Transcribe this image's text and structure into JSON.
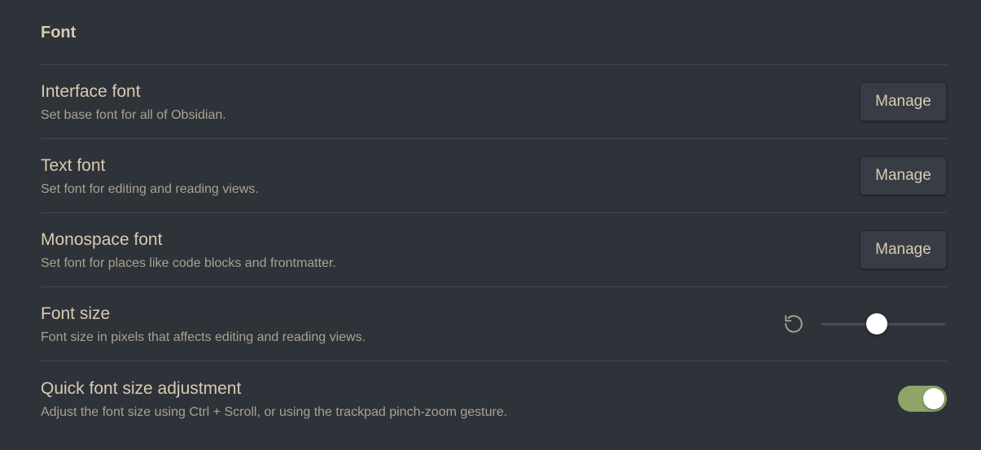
{
  "section": {
    "title": "Font"
  },
  "settings": [
    {
      "name": "Interface font",
      "description": "Set base font for all of Obsidian.",
      "button_label": "Manage"
    },
    {
      "name": "Text font",
      "description": "Set font for editing and reading views.",
      "button_label": "Manage"
    },
    {
      "name": "Monospace font",
      "description": "Set font for places like code blocks and frontmatter.",
      "button_label": "Manage"
    },
    {
      "name": "Font size",
      "description": "Font size in pixels that affects editing and reading views.",
      "reset_icon": "reset-icon",
      "slider_value_fraction": 0.45
    },
    {
      "name": "Quick font size adjustment",
      "description": "Adjust the font size using Ctrl + Scroll, or using the trackpad pinch-zoom gesture.",
      "toggle_on": true
    }
  ],
  "colors": {
    "background": "#2e3239",
    "accent_toggle": "#8fa468",
    "text": "#d8cbb0",
    "muted_text": "#a9a291"
  }
}
